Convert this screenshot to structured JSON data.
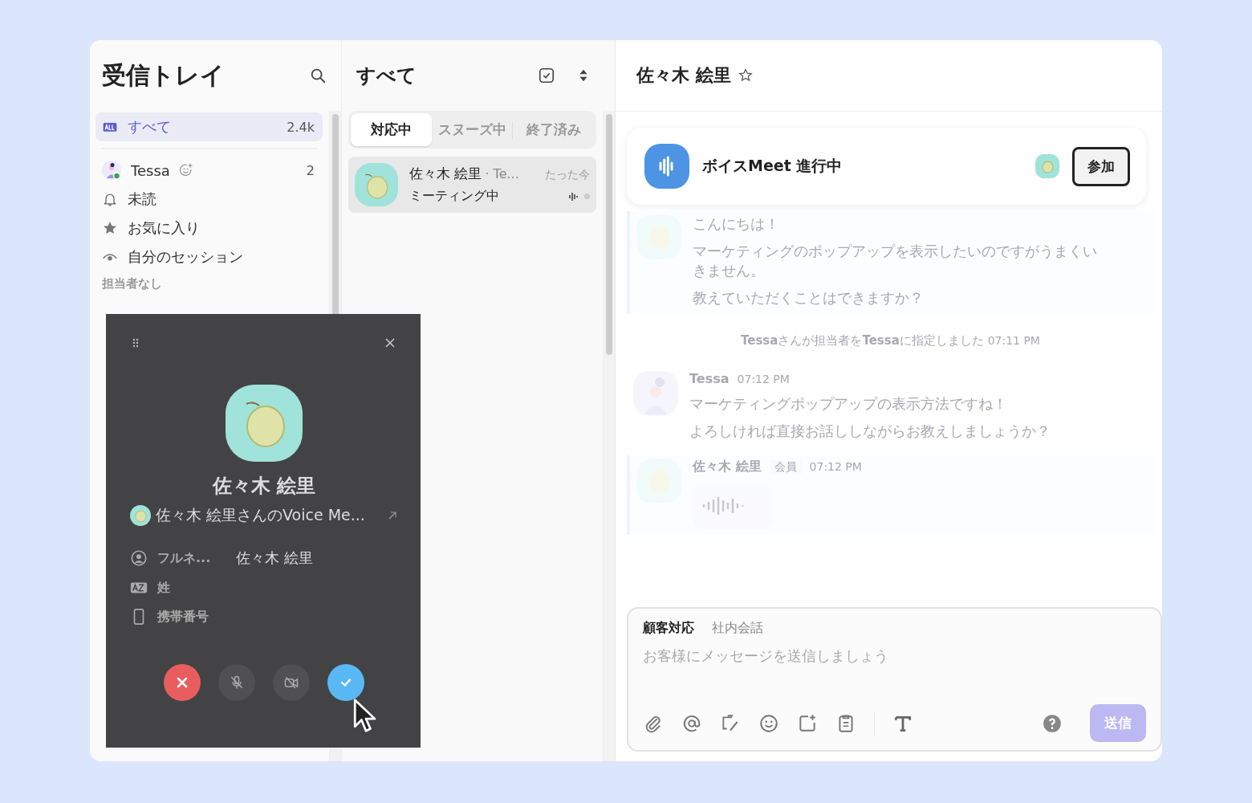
{
  "sidebar": {
    "title": "受信トレイ",
    "items": [
      {
        "kind": "all",
        "label": "すべて",
        "count": "2.4k",
        "selected": true
      },
      {
        "kind": "user",
        "label": "Tessa",
        "count": "2",
        "selected": false
      },
      {
        "kind": "bell",
        "label": "未読",
        "selected": false
      },
      {
        "kind": "star",
        "label": "お気に入り",
        "selected": false
      },
      {
        "kind": "eye",
        "label": "自分のセッション",
        "selected": false
      }
    ],
    "section": "担当者なし"
  },
  "list": {
    "title": "すべて",
    "tabs": [
      {
        "label": "対応中",
        "selected": true
      },
      {
        "label": "スヌーズ中",
        "selected": false
      },
      {
        "label": "終了済み",
        "selected": false
      }
    ],
    "conversations": [
      {
        "name": "佐々木 絵里",
        "assignee": "· Te...",
        "time": "たった今",
        "preview": "ミーティング中",
        "selected": true
      }
    ]
  },
  "chat": {
    "title": "佐々木 絵里",
    "banner": {
      "title": "ボイスMeet 進行中",
      "button": "参加"
    },
    "messages": [
      {
        "kind": "customer",
        "lines": [
          "こんにちは！",
          "マーケティングのポップアップを表示したいのですがうまくいきません。",
          "教えていただくことはできますか？"
        ]
      },
      {
        "kind": "system",
        "text": "**Tessa**さんが担当者を**Tessa**に指定しました",
        "time": "07:11 PM"
      },
      {
        "kind": "agent",
        "sender": "Tessa",
        "time": "07:12 PM",
        "lines": [
          "マーケティングポップアップの表示方法ですね！",
          "よろしければ直接お話ししながらお教えしましょうか？"
        ]
      },
      {
        "kind": "voice",
        "sender": "佐々木 絵里",
        "badge": "会員",
        "time": "07:12 PM"
      }
    ],
    "composer": {
      "tabs": [
        {
          "label": "顧客対応",
          "selected": true
        },
        {
          "label": "社内会話",
          "selected": false
        }
      ],
      "placeholder": "お客様にメッセージを送信しましょう",
      "send": "送信"
    }
  },
  "call_popup": {
    "name": "佐々木 絵里",
    "meeting": "佐々木 絵里さんのVoice Me...",
    "fields": [
      {
        "kind": "person",
        "label": "フルネ...",
        "value": "佐々木 絵里"
      },
      {
        "kind": "az",
        "label": "姓"
      },
      {
        "kind": "phone",
        "label": "携帯番号"
      }
    ]
  }
}
